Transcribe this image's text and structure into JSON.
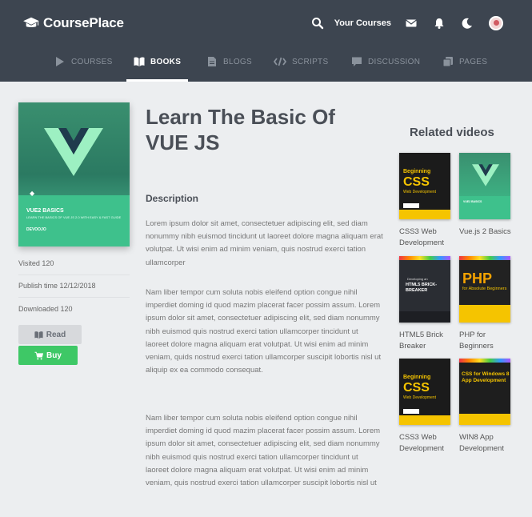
{
  "brand": {
    "name": "CoursePlace"
  },
  "header": {
    "your_courses": "Your Courses"
  },
  "nav": {
    "items": [
      {
        "label": "COURSES"
      },
      {
        "label": "BOOKS"
      },
      {
        "label": "BLOGS"
      },
      {
        "label": "SCRIPTS"
      },
      {
        "label": "DISCUSSION"
      },
      {
        "label": "PAGES"
      }
    ],
    "active": "BOOKS"
  },
  "book": {
    "title": "Learn The Basic Of VUE JS",
    "cover": {
      "title": "VUE2 BASICS",
      "subtitle": "LEARN THE BASICS OF VUE JS 2.0 WITH EASY & FAST GUIDE",
      "publisher": "DEVOOJO"
    },
    "visited": "Visited 120",
    "publish_time": "Publish time 12/12/2018",
    "downloaded": "Downloaded 120",
    "read_label": "Read",
    "buy_label": "Buy"
  },
  "description": {
    "heading": "Description",
    "paragraphs": [
      "Lorem ipsum dolor sit amet, consectetuer adipiscing elit, sed diam nonummy nibh euismod tincidunt ut laoreet dolore magna aliquam erat volutpat. Ut wisi enim ad minim veniam, quis nostrud exerci tation ullamcorper",
      "Nam liber tempor cum soluta nobis eleifend option congue nihil imperdiet doming id quod mazim placerat facer possim assum. Lorem ipsum dolor sit amet, consectetuer adipiscing elit, sed diam nonummy nibh euismod quis nostrud exerci tation ullamcorper tincidunt ut laoreet dolore magna aliquam erat volutpat. Ut wisi enim ad minim veniam, quids nostrud exerci tation ullamcorper suscipit lobortis nisl ut aliquip ex ea commodo consequat.",
      "Nam liber tempor cum soluta nobis eleifend option congue nihil imperdiet doming id quod mazim placerat facer possim assum. Lorem ipsum dolor sit amet, consectetuer adipiscing elit, sed diam nonummy nibh euismod quis nostrud exerci tation ullamcorper tincidunt ut laoreet dolore magna aliquam erat volutpat. Ut wisi enim ad minim veniam, quis nostrud exerci tation ullamcorper suscipit lobortis nisl ut"
    ]
  },
  "related": {
    "heading": "Related videos",
    "videos": [
      {
        "title": "CSS3 Web Development"
      },
      {
        "title": "Vue.js 2 Basics"
      },
      {
        "title": "HTML5 Brick Breaker"
      },
      {
        "title": "PHP for Beginners"
      },
      {
        "title": "CSS3 Web Development"
      },
      {
        "title": "WIN8 App Development"
      }
    ],
    "thumbs": {
      "css_heading": "Beginning",
      "css_big": "CSS",
      "css_sub": "Web Development",
      "html5_line1": "Developing an",
      "html5_line2": "HTML5 BRICK-BREAKER",
      "php_big": "PHP",
      "php_sub": "for Absolute Beginners",
      "win8_text": "CSS for Windows 8 App Development"
    }
  },
  "colors": {
    "header_bg": "#3d4550",
    "buy": "#3ec866",
    "page_bg": "#eceef0"
  }
}
